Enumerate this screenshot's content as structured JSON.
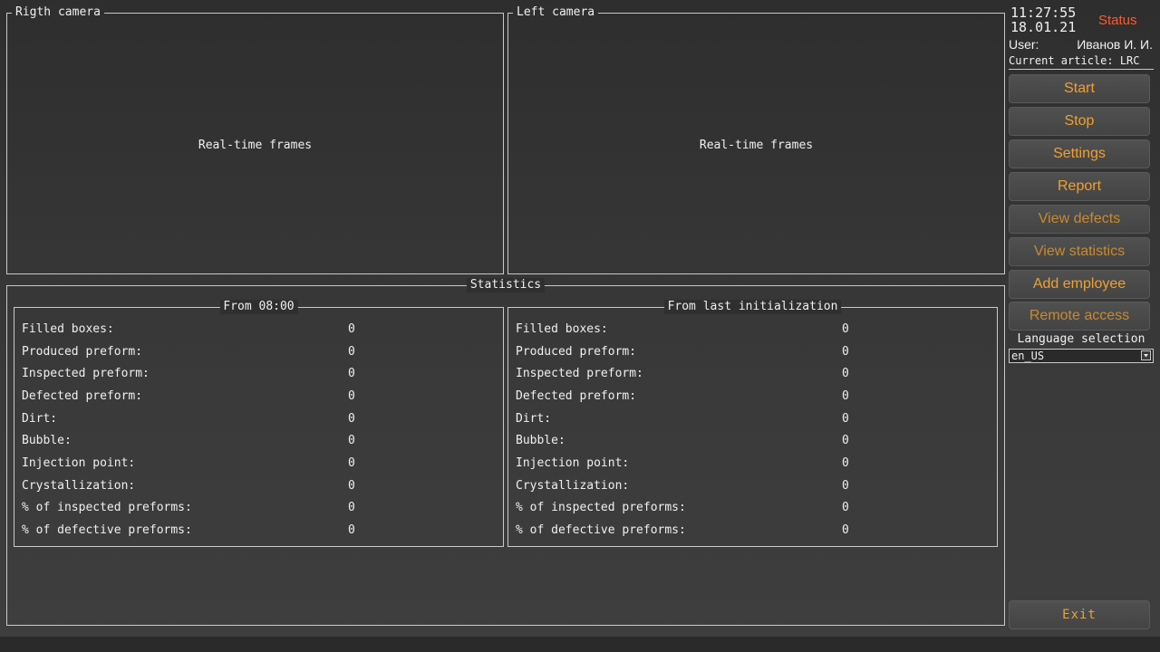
{
  "right_camera": {
    "title": "Rigth camera",
    "placeholder": "Real-time frames"
  },
  "left_camera": {
    "title": "Left camera",
    "placeholder": "Real-time frames"
  },
  "statistics": {
    "title": "Statistics",
    "from_shift": {
      "title": "From 08:00",
      "rows": [
        {
          "label": "Filled boxes:",
          "value": "0"
        },
        {
          "label": "Produced preform:",
          "value": "0"
        },
        {
          "label": "Inspected preform:",
          "value": "0"
        },
        {
          "label": "Defected preform:",
          "value": "0"
        },
        {
          "label": "Dirt:",
          "value": "0"
        },
        {
          "label": "Bubble:",
          "value": "0"
        },
        {
          "label": "Injection point:",
          "value": "0"
        },
        {
          "label": "Crystallization:",
          "value": "0"
        },
        {
          "label": "% of inspected preforms:",
          "value": "0"
        },
        {
          "label": "% of defective preforms:",
          "value": "0"
        }
      ]
    },
    "from_init": {
      "title": "From last initialization",
      "rows": [
        {
          "label": "Filled boxes:",
          "value": "0"
        },
        {
          "label": "Produced preform:",
          "value": "0"
        },
        {
          "label": "Inspected preform:",
          "value": "0"
        },
        {
          "label": "Defected preform:",
          "value": "0"
        },
        {
          "label": "Dirt:",
          "value": "0"
        },
        {
          "label": "Bubble:",
          "value": "0"
        },
        {
          "label": "Injection point:",
          "value": "0"
        },
        {
          "label": "Crystallization:",
          "value": "0"
        },
        {
          "label": "% of inspected preforms:",
          "value": "0"
        },
        {
          "label": "% of defective preforms:",
          "value": "0"
        }
      ]
    }
  },
  "sidebar": {
    "time": "11:27:55",
    "date": "18.01.21",
    "status": "Status",
    "user_label": "User:",
    "user_name": "Иванов И. И.",
    "article": "Current article: LRC",
    "buttons": [
      "Start",
      "Stop",
      "Settings",
      "Report",
      "View defects",
      "View statistics",
      "Add employee",
      "Remote access"
    ],
    "language_label": "Language selection",
    "language_value": "en_US",
    "exit": "Exit"
  },
  "colors": {
    "accent": "#f0a030",
    "status": "#ff5a2a",
    "border": "#c9c9c9"
  }
}
